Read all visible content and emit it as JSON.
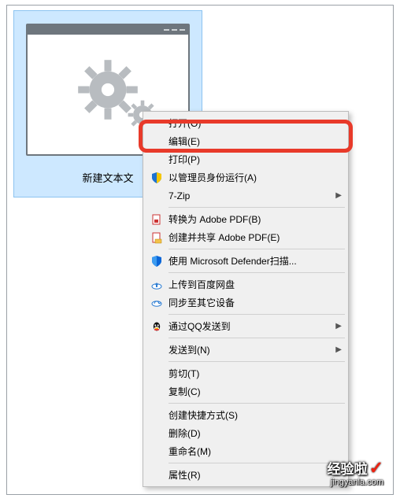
{
  "file": {
    "label": "新建文本文"
  },
  "menu": {
    "open": "打开(O)",
    "edit": "编辑(E)",
    "print": "打印(P)",
    "runas": "以管理员身份运行(A)",
    "sevenzip": "7-Zip",
    "convertpdf": "转换为 Adobe PDF(B)",
    "createshare": "创建并共享 Adobe PDF(E)",
    "defender": "使用 Microsoft Defender扫描...",
    "baidu_upload": "上传到百度网盘",
    "baidu_sync": "同步至其它设备",
    "qq": "通过QQ发送到",
    "sendto": "发送到(N)",
    "cut": "剪切(T)",
    "copy": "复制(C)",
    "shortcut": "创建快捷方式(S)",
    "delete": "删除(D)",
    "rename": "重命名(M)",
    "properties": "属性(R)"
  },
  "watermark": {
    "title": "经验啦",
    "url": "jingyanla.com"
  }
}
